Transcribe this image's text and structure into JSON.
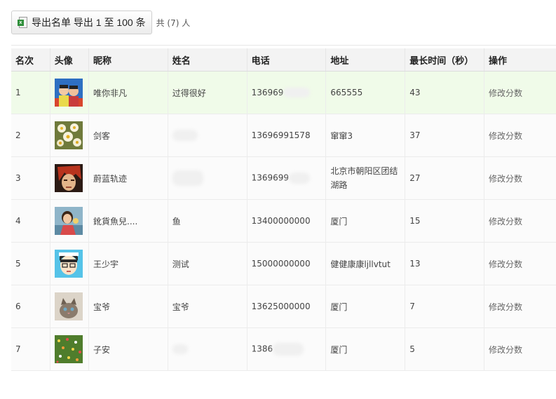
{
  "toolbar": {
    "export_label": "导出名单 导出 1 至 100 条",
    "total_text": "共 (7) 人"
  },
  "table": {
    "headers": [
      "名次",
      "头像",
      "昵称",
      "姓名",
      "电话",
      "地址",
      "最长时间（秒）",
      "操作"
    ],
    "rows": [
      {
        "rank": "1",
        "avatar": "avatar-kids",
        "nick": "唯你非凡",
        "name": "过得很好",
        "phone": "136969",
        "addr": "665555",
        "time": "43",
        "op": "修改分数"
      },
      {
        "rank": "2",
        "avatar": "avatar-flowers",
        "nick": "剑客",
        "name": "",
        "phone": "13696991578",
        "addr": "窜窜3",
        "time": "37",
        "op": "修改分数"
      },
      {
        "rank": "3",
        "avatar": "avatar-redhair",
        "nick": "蔚蓝轨迹",
        "name": "",
        "phone": "1369699",
        "addr": "北京市朝阳区团结湖路",
        "time": "27",
        "op": "修改分数"
      },
      {
        "rank": "4",
        "avatar": "avatar-girl",
        "nick": "鈋貨魚兒....",
        "name": "鱼",
        "phone": "13400000000",
        "addr": "厦门",
        "time": "15",
        "op": "修改分数"
      },
      {
        "rank": "5",
        "avatar": "avatar-cartoon",
        "nick": "王少宇",
        "name": "测试",
        "phone": "15000000000",
        "addr": "健健康康ljllvtut",
        "time": "13",
        "op": "修改分数"
      },
      {
        "rank": "6",
        "avatar": "avatar-cat",
        "nick": "宝爷",
        "name": "宝爷",
        "phone": "13625000000",
        "addr": "厦门",
        "time": "7",
        "op": "修改分数"
      },
      {
        "rank": "7",
        "avatar": "avatar-meadow",
        "nick": "子安",
        "name": "",
        "phone": "1386",
        "addr": "厦门",
        "time": "5",
        "op": "修改分数"
      }
    ]
  }
}
